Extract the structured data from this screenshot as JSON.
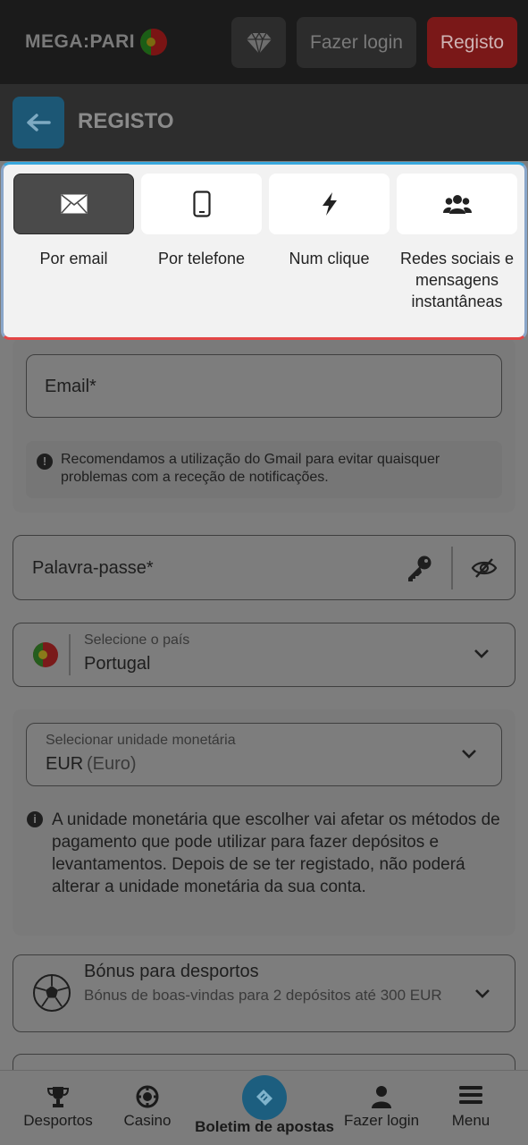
{
  "header": {
    "logo_text": "MEGA:PARI",
    "login_label": "Fazer login",
    "register_label": "Registo"
  },
  "titlebar": {
    "title": "REGISTO"
  },
  "tabs": [
    {
      "label": "Por email",
      "icon": "envelope-icon",
      "active": true
    },
    {
      "label": "Por telefone",
      "icon": "phone-icon",
      "active": false
    },
    {
      "label": "Num clique",
      "icon": "lightning-icon",
      "active": false
    },
    {
      "label": "Redes sociais e mensagens instantâneas",
      "icon": "users-icon",
      "active": false
    }
  ],
  "form": {
    "email_label": "Email*",
    "gmail_notice": "Recomendamos a utilização do Gmail para evitar quaisquer problemas com a receção de notificações.",
    "password_label": "Palavra-passe*",
    "country_label": "Selecione o país",
    "country_value": "Portugal",
    "currency_label": "Selecionar unidade monetária",
    "currency_code": "EUR",
    "currency_name": "(Euro)",
    "currency_notice": "A unidade monetária que escolher vai afetar os métodos de pagamento que pode utilizar para fazer depósitos e levantamentos. Depois de se ter registado, não poderá alterar a unidade monetária da sua conta.",
    "bonus_title": "Bónus para desportos",
    "bonus_desc": "Bónus de boas-vindas para 2 depósitos até 300 EUR"
  },
  "bottom_nav": [
    {
      "label": "Desportos",
      "icon": "trophy-icon"
    },
    {
      "label": "Casino",
      "icon": "casino-chip-icon"
    },
    {
      "label": "Boletim de apostas",
      "icon": "ticket-icon"
    },
    {
      "label": "Fazer login",
      "icon": "user-icon"
    },
    {
      "label": "Menu",
      "icon": "hamburger-icon"
    }
  ],
  "colors": {
    "accent_blue": "#39a8dd",
    "brand_red": "#e34646",
    "active_tab": "#4a4a4a"
  }
}
